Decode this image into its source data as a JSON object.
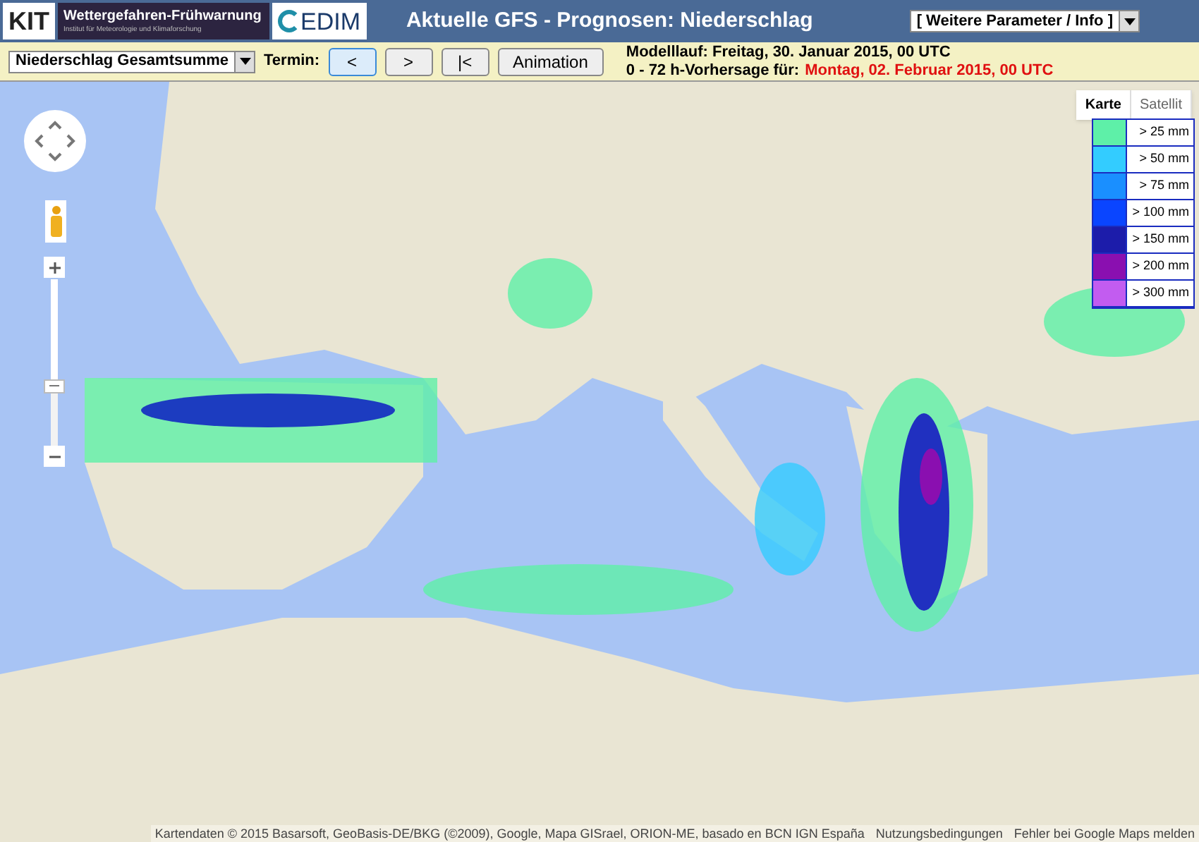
{
  "header": {
    "kit_logo": "KIT",
    "banner_title": "Wettergefahren-Frühwarnung",
    "banner_subtitle": "Institut für Meteorologie und Klimaforschung",
    "cedim_logo": "EDIM",
    "title": "Aktuelle GFS - Prognosen: Niederschlag",
    "menu": "[ Weitere Parameter / Info ]"
  },
  "toolbar": {
    "parameter": "Niederschlag Gesamtsumme",
    "termin_label": "Termin:",
    "buttons": [
      {
        "label": "<",
        "selected": true
      },
      {
        "label": ">",
        "selected": false
      },
      {
        "label": "|<",
        "selected": false
      },
      {
        "label": "Animation",
        "selected": false
      }
    ],
    "model_run": "Modelllauf: Freitag, 30. Januar 2015, 00 UTC",
    "forecast_label": "0 - 72 h-Vorhersage für:",
    "forecast_date": "Montag, 02. Februar 2015, 00 UTC"
  },
  "map": {
    "kind": "picture",
    "zoom": {
      "level": 0.36
    },
    "map_types": [
      {
        "label": "Karte",
        "selected": true
      },
      {
        "label": "Satellit",
        "selected": false
      }
    ],
    "legend": [
      {
        "label": "> 25 mm",
        "color": "#5ef0a8"
      },
      {
        "label": "> 50 mm",
        "color": "#33ccff"
      },
      {
        "label": "> 75 mm",
        "color": "#1a8fff"
      },
      {
        "label": "> 100 mm",
        "color": "#0a45ff"
      },
      {
        "label": "> 150 mm",
        "color": "#1c1caa"
      },
      {
        "label": "> 200 mm",
        "color": "#8a0fb0"
      },
      {
        "label": "> 300 mm",
        "color": "#c25cf0"
      }
    ],
    "attribution": "Kartendaten © 2015 Basarsoft, GeoBasis-DE/BKG (©2009), Google, Mapa GISrael, ORION-ME, basado en BCN IGN España",
    "links": [
      "Nutzungsbedingungen",
      "Fehler bei Google Maps melden"
    ]
  }
}
